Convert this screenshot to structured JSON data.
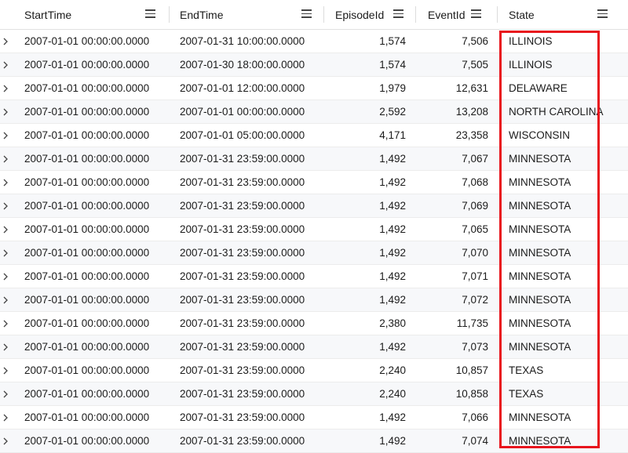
{
  "columns": [
    {
      "key": "start",
      "label": "StartTime",
      "icon": "column-menu-icon"
    },
    {
      "key": "end",
      "label": "EndTime",
      "icon": "column-menu-icon"
    },
    {
      "key": "episode",
      "label": "EpisodeId",
      "icon": "column-menu-icon"
    },
    {
      "key": "event",
      "label": "EventId",
      "icon": "column-menu-icon"
    },
    {
      "key": "state",
      "label": "State",
      "icon": "column-menu-icon"
    }
  ],
  "row_expand_icon": "chevron-right-icon",
  "highlight_color": "#e8141d",
  "rows": [
    {
      "start": "2007-01-01 00:00:00.0000",
      "end": "2007-01-31 10:00:00.0000",
      "episode": "1,574",
      "event": "7,506",
      "state": "ILLINOIS"
    },
    {
      "start": "2007-01-01 00:00:00.0000",
      "end": "2007-01-30 18:00:00.0000",
      "episode": "1,574",
      "event": "7,505",
      "state": "ILLINOIS"
    },
    {
      "start": "2007-01-01 00:00:00.0000",
      "end": "2007-01-01 12:00:00.0000",
      "episode": "1,979",
      "event": "12,631",
      "state": "DELAWARE"
    },
    {
      "start": "2007-01-01 00:00:00.0000",
      "end": "2007-01-01 00:00:00.0000",
      "episode": "2,592",
      "event": "13,208",
      "state": "NORTH CAROLINA"
    },
    {
      "start": "2007-01-01 00:00:00.0000",
      "end": "2007-01-01 05:00:00.0000",
      "episode": "4,171",
      "event": "23,358",
      "state": "WISCONSIN"
    },
    {
      "start": "2007-01-01 00:00:00.0000",
      "end": "2007-01-31 23:59:00.0000",
      "episode": "1,492",
      "event": "7,067",
      "state": "MINNESOTA"
    },
    {
      "start": "2007-01-01 00:00:00.0000",
      "end": "2007-01-31 23:59:00.0000",
      "episode": "1,492",
      "event": "7,068",
      "state": "MINNESOTA"
    },
    {
      "start": "2007-01-01 00:00:00.0000",
      "end": "2007-01-31 23:59:00.0000",
      "episode": "1,492",
      "event": "7,069",
      "state": "MINNESOTA"
    },
    {
      "start": "2007-01-01 00:00:00.0000",
      "end": "2007-01-31 23:59:00.0000",
      "episode": "1,492",
      "event": "7,065",
      "state": "MINNESOTA"
    },
    {
      "start": "2007-01-01 00:00:00.0000",
      "end": "2007-01-31 23:59:00.0000",
      "episode": "1,492",
      "event": "7,070",
      "state": "MINNESOTA"
    },
    {
      "start": "2007-01-01 00:00:00.0000",
      "end": "2007-01-31 23:59:00.0000",
      "episode": "1,492",
      "event": "7,071",
      "state": "MINNESOTA"
    },
    {
      "start": "2007-01-01 00:00:00.0000",
      "end": "2007-01-31 23:59:00.0000",
      "episode": "1,492",
      "event": "7,072",
      "state": "MINNESOTA"
    },
    {
      "start": "2007-01-01 00:00:00.0000",
      "end": "2007-01-31 23:59:00.0000",
      "episode": "2,380",
      "event": "11,735",
      "state": "MINNESOTA"
    },
    {
      "start": "2007-01-01 00:00:00.0000",
      "end": "2007-01-31 23:59:00.0000",
      "episode": "1,492",
      "event": "7,073",
      "state": "MINNESOTA"
    },
    {
      "start": "2007-01-01 00:00:00.0000",
      "end": "2007-01-31 23:59:00.0000",
      "episode": "2,240",
      "event": "10,857",
      "state": "TEXAS"
    },
    {
      "start": "2007-01-01 00:00:00.0000",
      "end": "2007-01-31 23:59:00.0000",
      "episode": "2,240",
      "event": "10,858",
      "state": "TEXAS"
    },
    {
      "start": "2007-01-01 00:00:00.0000",
      "end": "2007-01-31 23:59:00.0000",
      "episode": "1,492",
      "event": "7,066",
      "state": "MINNESOTA"
    },
    {
      "start": "2007-01-01 00:00:00.0000",
      "end": "2007-01-31 23:59:00.0000",
      "episode": "1,492",
      "event": "7,074",
      "state": "MINNESOTA"
    }
  ]
}
